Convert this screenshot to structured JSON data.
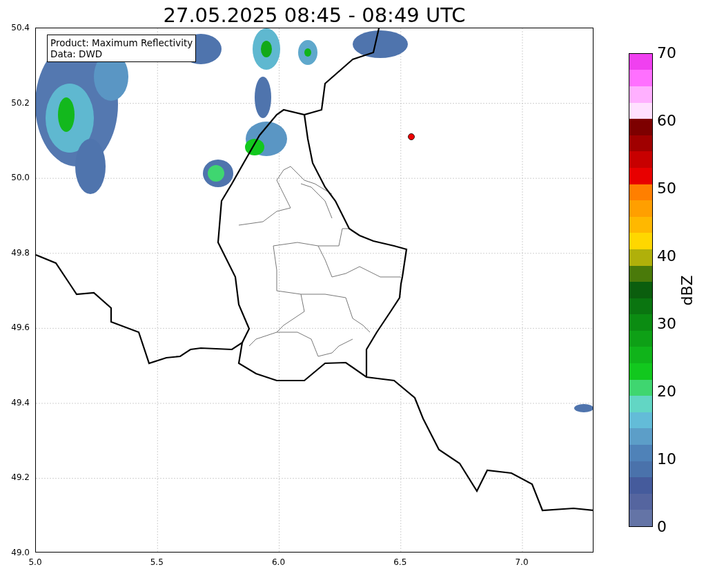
{
  "title": "27.05.2025 08:45 - 08:49 UTC",
  "info_box": [
    "Product: Maximum Reflectivity",
    "Data: DWD"
  ],
  "x_ticks": [
    "5.0",
    "5.5",
    "6.0",
    "6.5",
    "7.0"
  ],
  "y_ticks": [
    "50.4",
    "50.2",
    "50.0",
    "49.8",
    "49.6",
    "49.4",
    "49.2",
    "49.0"
  ],
  "colorbar": {
    "label": "dBZ",
    "ticks": [
      "70",
      "60",
      "50",
      "40",
      "30",
      "20",
      "10",
      "0"
    ],
    "segments": [
      {
        "color": "#6474a6"
      },
      {
        "color": "#55659f"
      },
      {
        "color": "#455b9c"
      },
      {
        "color": "#4a72ab"
      },
      {
        "color": "#4f82b8"
      },
      {
        "color": "#5c9ec8"
      },
      {
        "color": "#63bcd8"
      },
      {
        "color": "#62d6c4"
      },
      {
        "color": "#3fd670"
      },
      {
        "color": "#12c81e"
      },
      {
        "color": "#10b41a"
      },
      {
        "color": "#0ea016"
      },
      {
        "color": "#0b8c12"
      },
      {
        "color": "#0a7510"
      },
      {
        "color": "#0b5e0e"
      },
      {
        "color": "#4a7a0a"
      },
      {
        "color": "#b0b00a"
      },
      {
        "color": "#ffd700"
      },
      {
        "color": "#ffb800"
      },
      {
        "color": "#ff9f00"
      },
      {
        "color": "#ff7f00"
      },
      {
        "color": "#e80000"
      },
      {
        "color": "#c80000"
      },
      {
        "color": "#a00000"
      },
      {
        "color": "#7d0000"
      },
      {
        "color": "#ffe0ff"
      },
      {
        "color": "#ffb0ff"
      },
      {
        "color": "#ff70ff"
      },
      {
        "color": "#f040f0"
      }
    ]
  }
}
